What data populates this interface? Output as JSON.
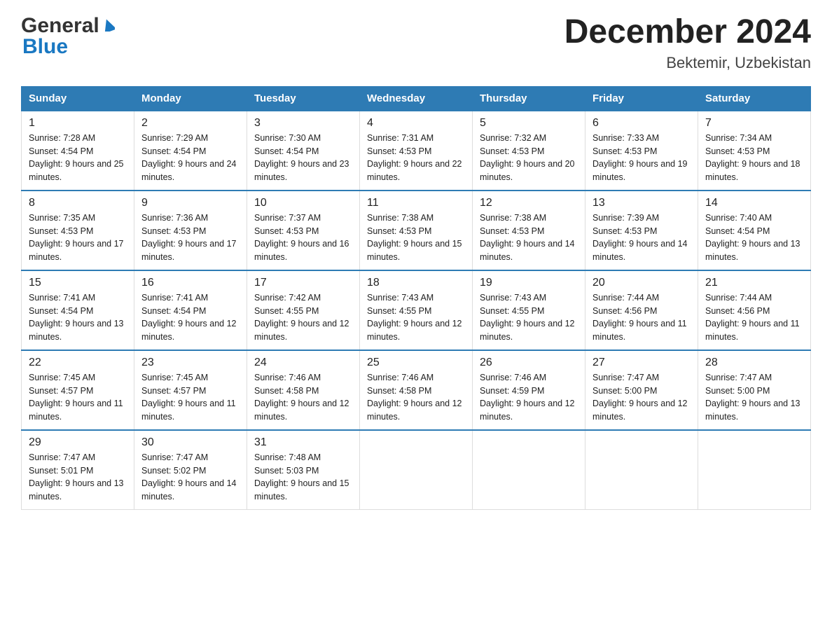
{
  "header": {
    "logo_general": "General",
    "logo_blue": "Blue",
    "month_title": "December 2024",
    "location": "Bektemir, Uzbekistan"
  },
  "days_of_week": [
    "Sunday",
    "Monday",
    "Tuesday",
    "Wednesday",
    "Thursday",
    "Friday",
    "Saturday"
  ],
  "weeks": [
    [
      {
        "day": "1",
        "sunrise": "7:28 AM",
        "sunset": "4:54 PM",
        "daylight": "9 hours and 25 minutes."
      },
      {
        "day": "2",
        "sunrise": "7:29 AM",
        "sunset": "4:54 PM",
        "daylight": "9 hours and 24 minutes."
      },
      {
        "day": "3",
        "sunrise": "7:30 AM",
        "sunset": "4:54 PM",
        "daylight": "9 hours and 23 minutes."
      },
      {
        "day": "4",
        "sunrise": "7:31 AM",
        "sunset": "4:53 PM",
        "daylight": "9 hours and 22 minutes."
      },
      {
        "day": "5",
        "sunrise": "7:32 AM",
        "sunset": "4:53 PM",
        "daylight": "9 hours and 20 minutes."
      },
      {
        "day": "6",
        "sunrise": "7:33 AM",
        "sunset": "4:53 PM",
        "daylight": "9 hours and 19 minutes."
      },
      {
        "day": "7",
        "sunrise": "7:34 AM",
        "sunset": "4:53 PM",
        "daylight": "9 hours and 18 minutes."
      }
    ],
    [
      {
        "day": "8",
        "sunrise": "7:35 AM",
        "sunset": "4:53 PM",
        "daylight": "9 hours and 17 minutes."
      },
      {
        "day": "9",
        "sunrise": "7:36 AM",
        "sunset": "4:53 PM",
        "daylight": "9 hours and 17 minutes."
      },
      {
        "day": "10",
        "sunrise": "7:37 AM",
        "sunset": "4:53 PM",
        "daylight": "9 hours and 16 minutes."
      },
      {
        "day": "11",
        "sunrise": "7:38 AM",
        "sunset": "4:53 PM",
        "daylight": "9 hours and 15 minutes."
      },
      {
        "day": "12",
        "sunrise": "7:38 AM",
        "sunset": "4:53 PM",
        "daylight": "9 hours and 14 minutes."
      },
      {
        "day": "13",
        "sunrise": "7:39 AM",
        "sunset": "4:53 PM",
        "daylight": "9 hours and 14 minutes."
      },
      {
        "day": "14",
        "sunrise": "7:40 AM",
        "sunset": "4:54 PM",
        "daylight": "9 hours and 13 minutes."
      }
    ],
    [
      {
        "day": "15",
        "sunrise": "7:41 AM",
        "sunset": "4:54 PM",
        "daylight": "9 hours and 13 minutes."
      },
      {
        "day": "16",
        "sunrise": "7:41 AM",
        "sunset": "4:54 PM",
        "daylight": "9 hours and 12 minutes."
      },
      {
        "day": "17",
        "sunrise": "7:42 AM",
        "sunset": "4:55 PM",
        "daylight": "9 hours and 12 minutes."
      },
      {
        "day": "18",
        "sunrise": "7:43 AM",
        "sunset": "4:55 PM",
        "daylight": "9 hours and 12 minutes."
      },
      {
        "day": "19",
        "sunrise": "7:43 AM",
        "sunset": "4:55 PM",
        "daylight": "9 hours and 12 minutes."
      },
      {
        "day": "20",
        "sunrise": "7:44 AM",
        "sunset": "4:56 PM",
        "daylight": "9 hours and 11 minutes."
      },
      {
        "day": "21",
        "sunrise": "7:44 AM",
        "sunset": "4:56 PM",
        "daylight": "9 hours and 11 minutes."
      }
    ],
    [
      {
        "day": "22",
        "sunrise": "7:45 AM",
        "sunset": "4:57 PM",
        "daylight": "9 hours and 11 minutes."
      },
      {
        "day": "23",
        "sunrise": "7:45 AM",
        "sunset": "4:57 PM",
        "daylight": "9 hours and 11 minutes."
      },
      {
        "day": "24",
        "sunrise": "7:46 AM",
        "sunset": "4:58 PM",
        "daylight": "9 hours and 12 minutes."
      },
      {
        "day": "25",
        "sunrise": "7:46 AM",
        "sunset": "4:58 PM",
        "daylight": "9 hours and 12 minutes."
      },
      {
        "day": "26",
        "sunrise": "7:46 AM",
        "sunset": "4:59 PM",
        "daylight": "9 hours and 12 minutes."
      },
      {
        "day": "27",
        "sunrise": "7:47 AM",
        "sunset": "5:00 PM",
        "daylight": "9 hours and 12 minutes."
      },
      {
        "day": "28",
        "sunrise": "7:47 AM",
        "sunset": "5:00 PM",
        "daylight": "9 hours and 13 minutes."
      }
    ],
    [
      {
        "day": "29",
        "sunrise": "7:47 AM",
        "sunset": "5:01 PM",
        "daylight": "9 hours and 13 minutes."
      },
      {
        "day": "30",
        "sunrise": "7:47 AM",
        "sunset": "5:02 PM",
        "daylight": "9 hours and 14 minutes."
      },
      {
        "day": "31",
        "sunrise": "7:48 AM",
        "sunset": "5:03 PM",
        "daylight": "9 hours and 15 minutes."
      },
      null,
      null,
      null,
      null
    ]
  ],
  "colors": {
    "header_bg": "#2e7bb4",
    "header_text": "#ffffff",
    "border_accent": "#2e7bb4",
    "text_primary": "#222222"
  }
}
